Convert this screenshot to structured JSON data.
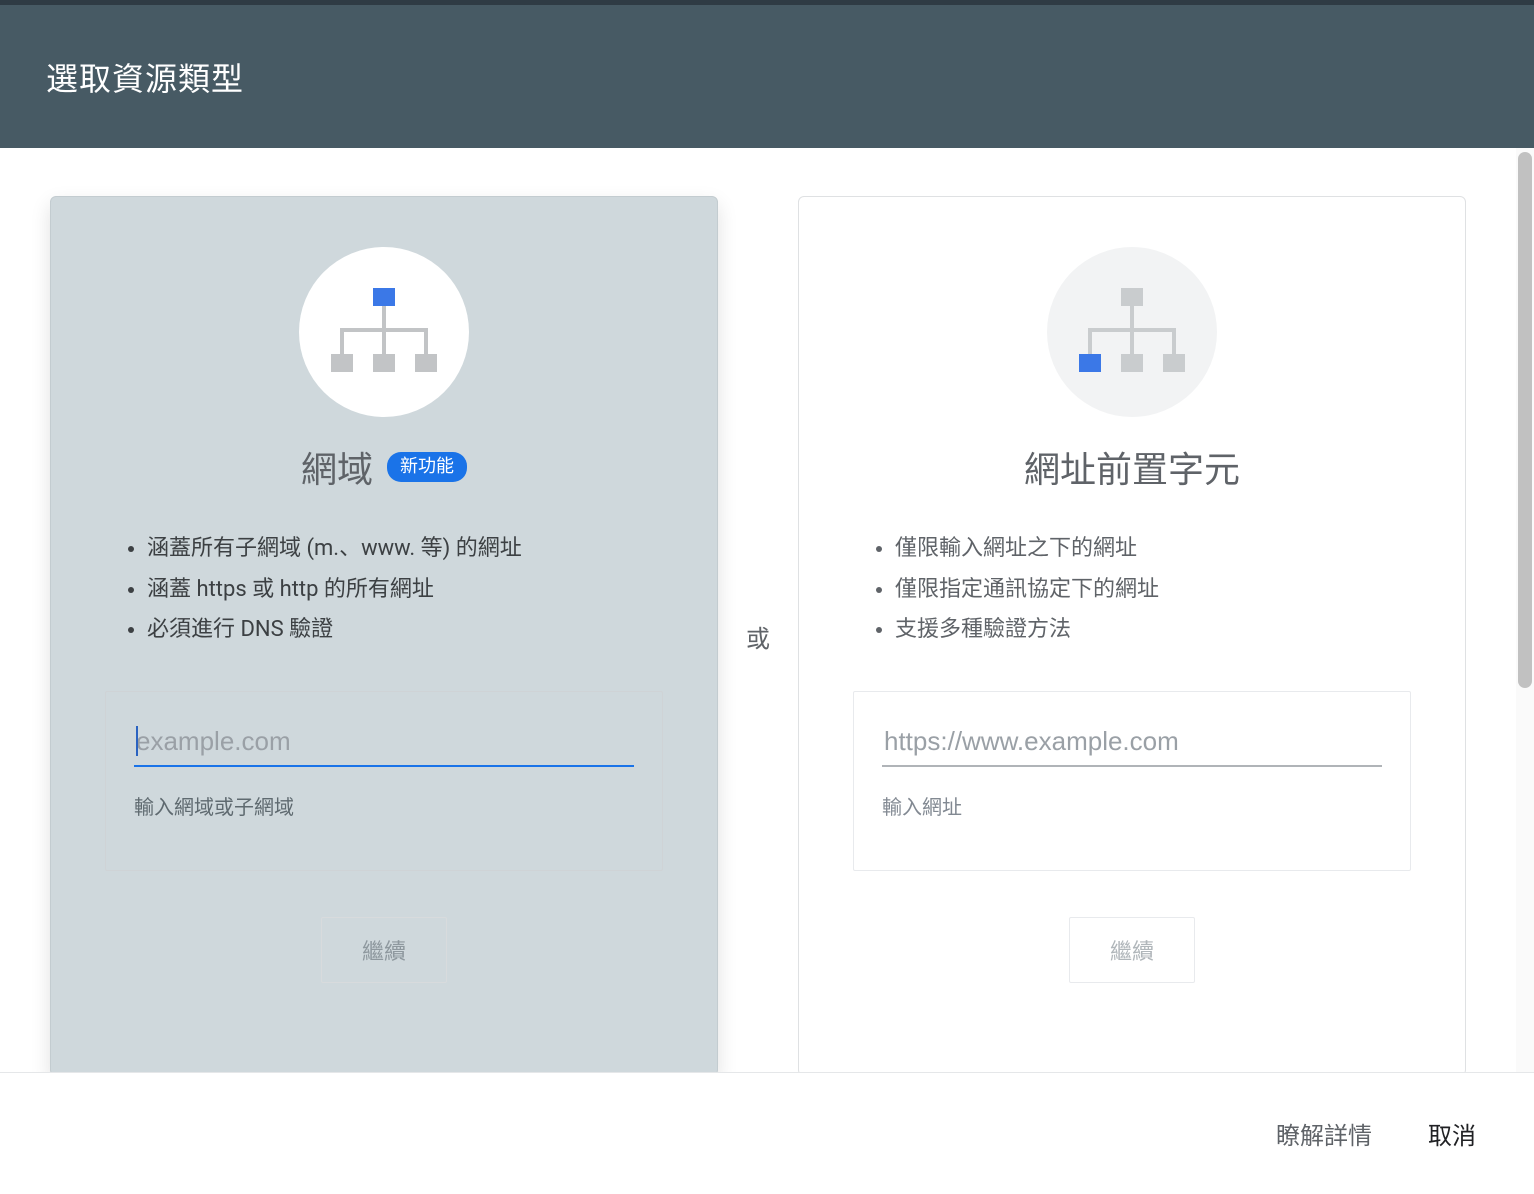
{
  "header": {
    "title": "選取資源類型"
  },
  "separator": "或",
  "cards": {
    "domain": {
      "title": "網域",
      "badge": "新功能",
      "bullets": [
        "涵蓋所有子網域 (m.、www. 等) 的網址",
        "涵蓋 https 或 http 的所有網址",
        "必須進行 DNS 驗證"
      ],
      "input_placeholder": "example.com",
      "input_value": "",
      "helper": "輸入網域或子網域",
      "continue": "繼續"
    },
    "prefix": {
      "title": "網址前置字元",
      "bullets": [
        "僅限輸入網址之下的網址",
        "僅限指定通訊協定下的網址",
        "支援多種驗證方法"
      ],
      "input_placeholder": "https://www.example.com",
      "input_value": "",
      "helper": "輸入網址",
      "continue": "繼續"
    }
  },
  "footer": {
    "learn_more": "瞭解詳情",
    "cancel": "取消"
  }
}
